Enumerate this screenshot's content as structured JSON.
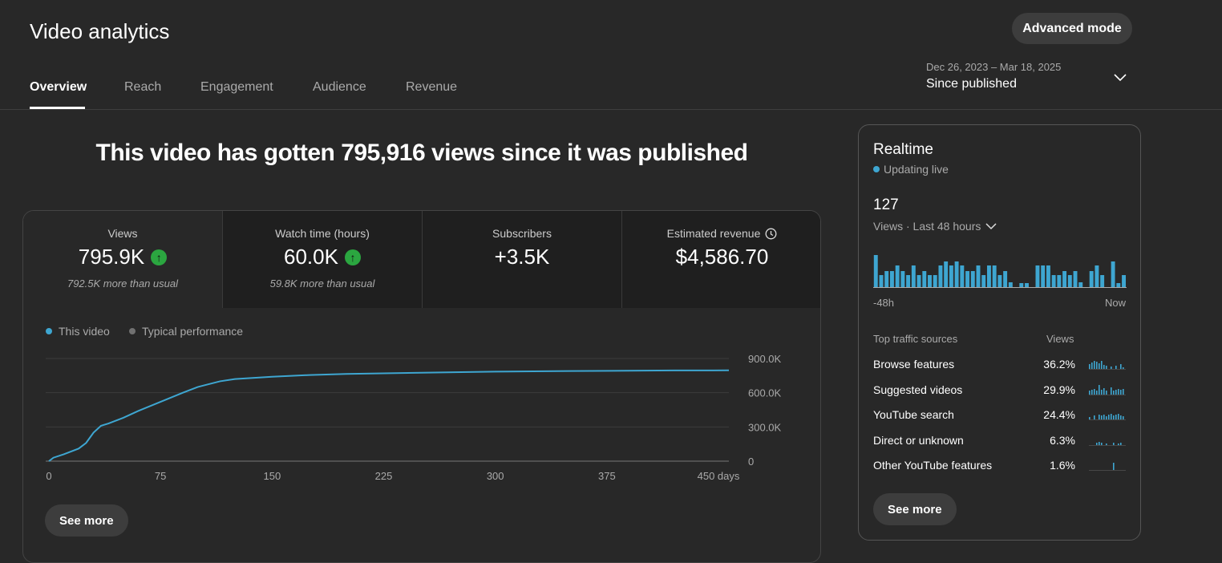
{
  "header": {
    "title": "Video analytics",
    "advanced_mode": "Advanced mode",
    "tabs": [
      {
        "label": "Overview",
        "active": true
      },
      {
        "label": "Reach"
      },
      {
        "label": "Engagement"
      },
      {
        "label": "Audience"
      },
      {
        "label": "Revenue"
      }
    ],
    "date_range": "Dec 26, 2023 – Mar 18, 2025",
    "period": "Since published"
  },
  "headline": "This video has gotten 795,916 views since it was published",
  "metrics": [
    {
      "label": "Views",
      "value": "795.9K",
      "trend": "up",
      "sub": "792.5K more than usual"
    },
    {
      "label": "Watch time (hours)",
      "value": "60.0K",
      "trend": "up",
      "sub": "59.8K more than usual"
    },
    {
      "label": "Subscribers",
      "value": "+3.5K",
      "sub": ""
    },
    {
      "label": "Estimated revenue",
      "value": "$4,586.70",
      "sub": "",
      "icon": "clock-icon"
    }
  ],
  "colors": {
    "this_video": "#3ea6d1",
    "typical": "#717171",
    "trend_up": "#2ba640"
  },
  "chart_data": {
    "type": "line",
    "legend": [
      "This video",
      "Typical performance"
    ],
    "xlabel": "",
    "ylabel": "",
    "x_ticks": [
      "0",
      "75",
      "150",
      "225",
      "300",
      "375",
      "450 days"
    ],
    "x_tick_values": [
      0,
      75,
      150,
      225,
      300,
      375,
      450
    ],
    "y_ticks": [
      "0",
      "300.0K",
      "600.0K",
      "900.0K"
    ],
    "y_tick_values": [
      0,
      300000,
      600000,
      900000
    ],
    "xlim": [
      0,
      457
    ],
    "ylim": [
      0,
      900000
    ],
    "grid": true,
    "series": [
      {
        "name": "This video",
        "x": [
          0,
          3,
          10,
          20,
          25,
          30,
          35,
          40,
          50,
          60,
          75,
          90,
          100,
          115,
          125,
          150,
          175,
          200,
          250,
          300,
          350,
          420,
          457
        ],
        "y": [
          0,
          30000,
          60000,
          110000,
          160000,
          250000,
          310000,
          330000,
          380000,
          440000,
          520000,
          600000,
          650000,
          700000,
          720000,
          740000,
          755000,
          765000,
          775000,
          785000,
          790000,
          795000,
          796000
        ]
      }
    ]
  },
  "see_more": "See more",
  "realtime": {
    "title": "Realtime",
    "status": "Updating live",
    "count": "127",
    "metric": "Views · Last 48 hours",
    "start_label": "-48h",
    "end_label": "Now",
    "bars": [
      40,
      15,
      20,
      20,
      27,
      20,
      15,
      27,
      15,
      20,
      15,
      15,
      27,
      32,
      27,
      32,
      27,
      20,
      20,
      27,
      15,
      27,
      27,
      15,
      20,
      6,
      0,
      5,
      5,
      0,
      27,
      27,
      27,
      15,
      15,
      20,
      15,
      20,
      6,
      0,
      20,
      27,
      15,
      0,
      32,
      5,
      15
    ],
    "sources_header": "Top traffic sources",
    "views_header": "Views",
    "sources": [
      {
        "name": "Browse features",
        "pct": "36.2%"
      },
      {
        "name": "Suggested videos",
        "pct": "29.9%"
      },
      {
        "name": "YouTube search",
        "pct": "24.4%"
      },
      {
        "name": "Direct or unknown",
        "pct": "6.3%"
      },
      {
        "name": "Other YouTube features",
        "pct": "1.6%"
      }
    ],
    "see_more": "See more"
  }
}
